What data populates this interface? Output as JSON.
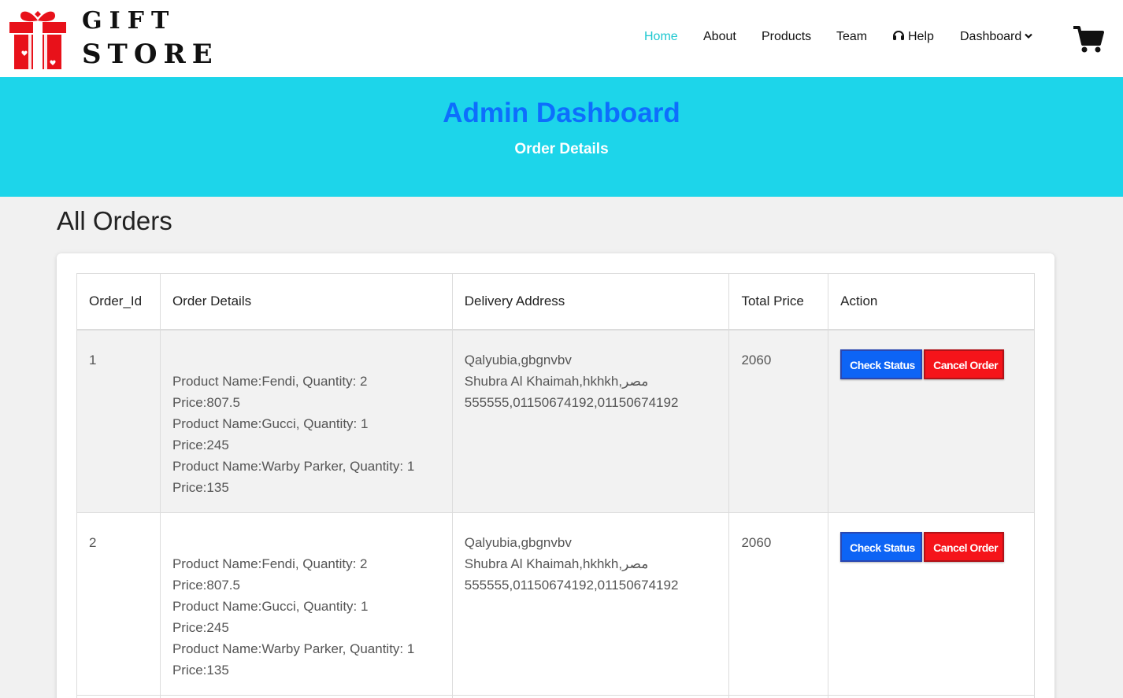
{
  "brand": {
    "line1": "GIFT",
    "line2": "STORE",
    "logo_icon": "gift-box-icon"
  },
  "nav": {
    "home": "Home",
    "about": "About",
    "products": "Products",
    "team": "Team",
    "help": "Help",
    "dashboard": "Dashboard",
    "help_icon": "headset-icon",
    "dashboard_icon": "chevron-down-icon",
    "cart_icon": "cart-icon"
  },
  "banner": {
    "title": "Admin Dashboard",
    "subtitle": "Order Details"
  },
  "section": {
    "title": "All Orders"
  },
  "table": {
    "headers": [
      "Order_Id",
      "Order Details",
      "Delivery Address",
      "Total Price",
      "Action"
    ],
    "rows": [
      {
        "id": "1",
        "details": [
          "Product Name:Fendi, Quantity: 2",
          "Price:807.5",
          "Product Name:Gucci, Quantity: 1",
          "Price:245",
          "Product Name:Warby Parker, Quantity: 1",
          "Price:135"
        ],
        "address": [
          "Qalyubia,gbgnvbv",
          "Shubra Al Khaimah,hkhkh,مصر",
          "555555,01150674192,01150674192"
        ],
        "total": "2060",
        "check_label": "Check Status",
        "cancel_label": "Cancel Order"
      },
      {
        "id": "2",
        "details": [
          "Product Name:Fendi, Quantity: 2",
          "Price:807.5",
          "Product Name:Gucci, Quantity: 1",
          "Price:245",
          "Product Name:Warby Parker, Quantity: 1",
          "Price:135"
        ],
        "address": [
          "Qalyubia,gbgnvbv",
          "Shubra Al Khaimah,hkhkh,مصر",
          "555555,01150674192,01150674192"
        ],
        "total": "2060",
        "check_label": "Check Status",
        "cancel_label": "Cancel Order"
      }
    ]
  },
  "colors": {
    "banner_bg": "#1dd5ea",
    "title_blue": "#0d6efd",
    "nav_active": "#1cc7d0",
    "btn_blue": "#0d64f5",
    "btn_red": "#f5141a",
    "logo_red": "#e8111a"
  }
}
